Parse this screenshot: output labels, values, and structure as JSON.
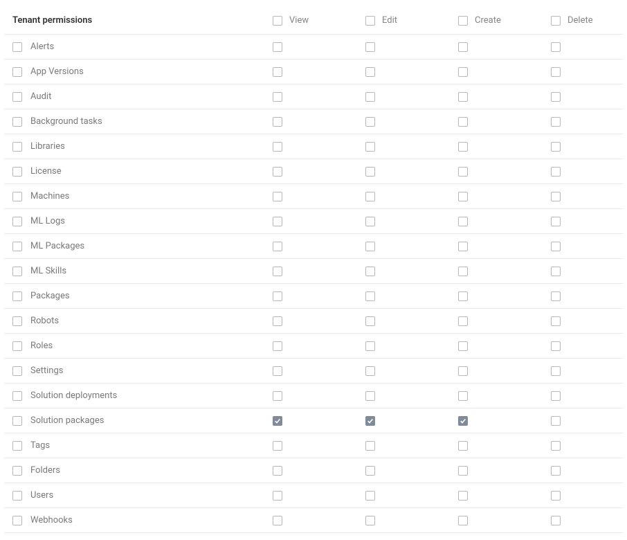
{
  "header": {
    "title": "Tenant permissions",
    "columns": [
      "View",
      "Edit",
      "Create",
      "Delete"
    ]
  },
  "rows": [
    {
      "name": "Alerts",
      "view": false,
      "edit": false,
      "create": false,
      "delete": false
    },
    {
      "name": "App Versions",
      "view": false,
      "edit": false,
      "create": false,
      "delete": false
    },
    {
      "name": "Audit",
      "view": false,
      "edit": false,
      "create": false,
      "delete": false
    },
    {
      "name": "Background tasks",
      "view": false,
      "edit": false,
      "create": false,
      "delete": false
    },
    {
      "name": "Libraries",
      "view": false,
      "edit": false,
      "create": false,
      "delete": false
    },
    {
      "name": "License",
      "view": false,
      "edit": false,
      "create": false,
      "delete": false
    },
    {
      "name": "Machines",
      "view": false,
      "edit": false,
      "create": false,
      "delete": false
    },
    {
      "name": "ML Logs",
      "view": false,
      "edit": false,
      "create": false,
      "delete": false
    },
    {
      "name": "ML Packages",
      "view": false,
      "edit": false,
      "create": false,
      "delete": false
    },
    {
      "name": "ML Skills",
      "view": false,
      "edit": false,
      "create": false,
      "delete": false
    },
    {
      "name": "Packages",
      "view": false,
      "edit": false,
      "create": false,
      "delete": false
    },
    {
      "name": "Robots",
      "view": false,
      "edit": false,
      "create": false,
      "delete": false
    },
    {
      "name": "Roles",
      "view": false,
      "edit": false,
      "create": false,
      "delete": false
    },
    {
      "name": "Settings",
      "view": false,
      "edit": false,
      "create": false,
      "delete": false
    },
    {
      "name": "Solution deployments",
      "view": false,
      "edit": false,
      "create": false,
      "delete": false
    },
    {
      "name": "Solution packages",
      "view": true,
      "edit": true,
      "create": true,
      "delete": false
    },
    {
      "name": "Tags",
      "view": false,
      "edit": false,
      "create": false,
      "delete": false
    },
    {
      "name": "Folders",
      "view": false,
      "edit": false,
      "create": false,
      "delete": false
    },
    {
      "name": "Users",
      "view": false,
      "edit": false,
      "create": false,
      "delete": false
    },
    {
      "name": "Webhooks",
      "view": false,
      "edit": false,
      "create": false,
      "delete": false
    }
  ]
}
